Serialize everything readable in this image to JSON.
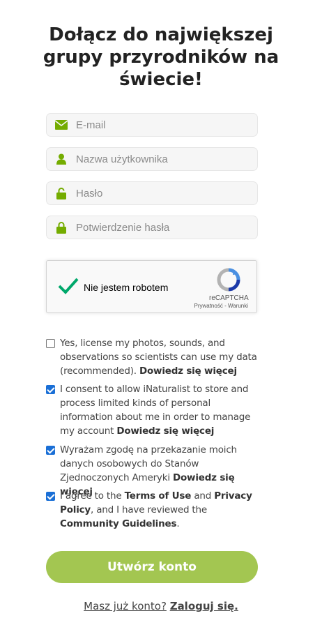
{
  "heading": {
    "line1": "Dołącz do największej",
    "line2": "grupy przyrodników na",
    "line3": "świecie!"
  },
  "form": {
    "email": {
      "placeholder": "E-mail",
      "icon": "envelope-icon"
    },
    "username": {
      "placeholder": "Nazwa użytkownika",
      "icon": "user-icon"
    },
    "password": {
      "placeholder": "Hasło",
      "icon": "unlock-icon"
    },
    "password_confirm": {
      "placeholder": "Potwierdzenie hasła",
      "icon": "lock-icon"
    }
  },
  "captcha": {
    "label": "Nie jestem robotem",
    "brand": "reCAPTCHA",
    "privacy": "Prywatność",
    "separator": " - ",
    "terms": "Warunki",
    "checked": true
  },
  "consents": [
    {
      "checked": false,
      "text": "Yes, license my photos, sounds, and observations so scientists can use my data (recommended).",
      "link": "Dowiedz się więcej"
    },
    {
      "checked": true,
      "text": "I consent to allow iNaturalist to store and process limited kinds of personal information about me in order to manage my account",
      "link": "Dowiedz się więcej"
    },
    {
      "checked": true,
      "text": "Wyrażam zgodę na przekazanie moich danych osobowych do Stanów Zjednoczonych Ameryki",
      "link": "Dowiedz się więcej"
    },
    {
      "checked": true,
      "pre": "I agree to the",
      "terms": "Terms of Use",
      "and": "and",
      "privacy": "Privacy Policy",
      "mid": ", and I have reviewed the",
      "guidelines": "Community Guidelines",
      "end": "."
    }
  ],
  "submit_label": "Utwórz konto",
  "signin": {
    "question": "Masz już konto?",
    "link": "Zaloguj się."
  },
  "colors": {
    "accent": "#74ac00",
    "button": "#a3c651",
    "checkbox": "#1a6fd6",
    "captcha_check": "#00a86b"
  }
}
